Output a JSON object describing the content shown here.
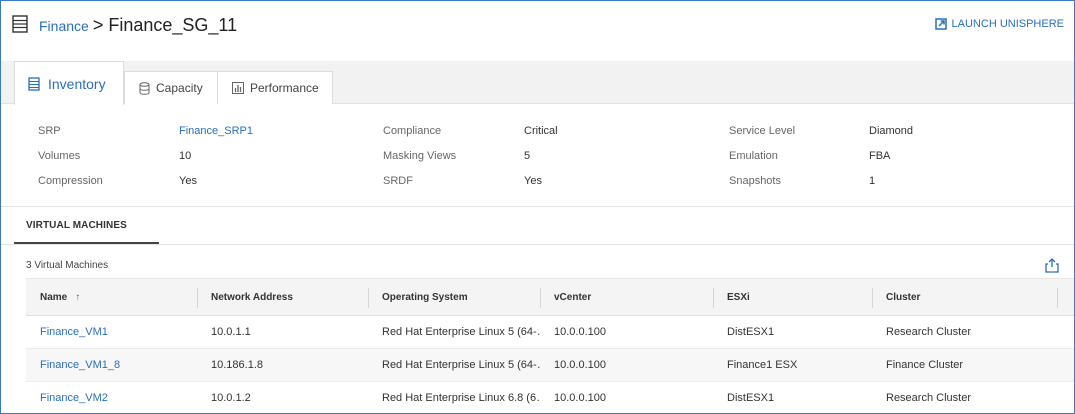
{
  "header": {
    "breadcrumb_parent": "Finance",
    "breadcrumb_separator": ">",
    "title": "Finance_SG_11",
    "launch_label": "LAUNCH UNISPHERE"
  },
  "tabs": [
    {
      "label": "Inventory",
      "active": true,
      "icon": "list-icon"
    },
    {
      "label": "Capacity",
      "active": false,
      "icon": "database-icon"
    },
    {
      "label": "Performance",
      "active": false,
      "icon": "bar-chart-icon"
    }
  ],
  "properties": {
    "srp_label": "SRP",
    "srp_value": "Finance_SRP1",
    "volumes_label": "Volumes",
    "volumes_value": "10",
    "compression_label": "Compression",
    "compression_value": "Yes",
    "compliance_label": "Compliance",
    "compliance_value": "Critical",
    "masking_label": "Masking Views",
    "masking_value": "5",
    "srdf_label": "SRDF",
    "srdf_value": "Yes",
    "service_label": "Service Level",
    "service_value": "Diamond",
    "emulation_label": "Emulation",
    "emulation_value": "FBA",
    "snapshots_label": "Snapshots",
    "snapshots_value": "1"
  },
  "vm_section": {
    "tab_label": "VIRTUAL MACHINES",
    "count_label": "3 Virtual Machines"
  },
  "table": {
    "columns": [
      "Name",
      "Network Address",
      "Operating System",
      "vCenter",
      "ESXi",
      "Cluster"
    ],
    "sort_indicator": "↑",
    "rows": [
      {
        "name": "Finance_VM1",
        "network": "10.0.1.1",
        "os": "Red Hat Enterprise Linux 5 (64-…",
        "vcenter": "10.0.0.100",
        "esxi": "DistESX1",
        "cluster": "Research Cluster"
      },
      {
        "name": "Finance_VM1_8",
        "network": "10.186.1.8",
        "os": "Red Hat Enterprise Linux 5 (64-…",
        "vcenter": "10.0.0.100",
        "esxi": "Finance1 ESX",
        "cluster": "Finance Cluster"
      },
      {
        "name": "Finance_VM2",
        "network": "10.0.1.2",
        "os": "Red Hat Enterprise Linux 6.8 (6…",
        "vcenter": "10.0.0.100",
        "esxi": "DistESX1",
        "cluster": "Research Cluster"
      }
    ]
  },
  "colors": {
    "accent": "#2a6ebb",
    "frame_border": "#3c78c8",
    "tab_band": "#f2f2f2"
  }
}
